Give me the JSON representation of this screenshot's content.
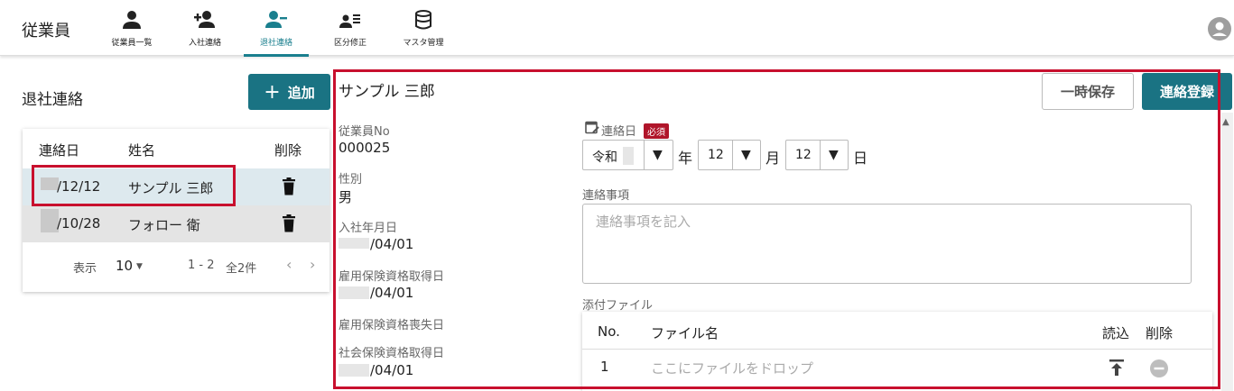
{
  "app": {
    "title": "従業員"
  },
  "nav": [
    {
      "label": "従業員一覧",
      "icon": "person-icon"
    },
    {
      "label": "入社連絡",
      "icon": "person-add-icon"
    },
    {
      "label": "退社連絡",
      "icon": "person-remove-icon"
    },
    {
      "label": "区分修正",
      "icon": "person-list-icon"
    },
    {
      "label": "マスタ管理",
      "icon": "database-icon"
    }
  ],
  "left": {
    "title": "退社連絡",
    "add_label": "追加",
    "table": {
      "headers": [
        "連絡日",
        "姓名",
        "削除"
      ],
      "rows": [
        {
          "date": "/12/12",
          "name": "サンプル 三郎"
        },
        {
          "date": "/10/28",
          "name": "フォロー 衛"
        }
      ]
    },
    "pager": {
      "label": "表示",
      "per_page": "10",
      "range": "1 - 2",
      "total": "全2件"
    }
  },
  "detail": {
    "name": "サンプル 三郎",
    "temp_save_label": "一時保存",
    "register_label": "連絡登録",
    "fields": [
      {
        "label": "従業員No",
        "value": "000025"
      },
      {
        "label": "性別",
        "value": "男"
      },
      {
        "label": "入社年月日",
        "value": "/04/01"
      },
      {
        "label": "雇用保険資格取得日",
        "value": "/04/01"
      },
      {
        "label": "雇用保険資格喪失日",
        "value": ""
      },
      {
        "label": "社会保険資格取得日",
        "value": "/04/01"
      }
    ],
    "contact_date": {
      "label": "連絡日",
      "required": "必須",
      "era": "令和",
      "year_unit": "年",
      "month": "12",
      "month_unit": "月",
      "day": "12",
      "day_unit": "日"
    },
    "notes": {
      "label": "連絡事項",
      "placeholder": "連絡事項を記入"
    },
    "attachments": {
      "label": "添付ファイル",
      "headers": [
        "No.",
        "ファイル名",
        "読込",
        "削除"
      ],
      "rows": [
        {
          "no": "1",
          "placeholder": "ここにファイルをドロップ"
        }
      ]
    }
  },
  "colors": {
    "accent": "#1a7383",
    "highlight": "#c8102e",
    "required": "#b0152a"
  }
}
